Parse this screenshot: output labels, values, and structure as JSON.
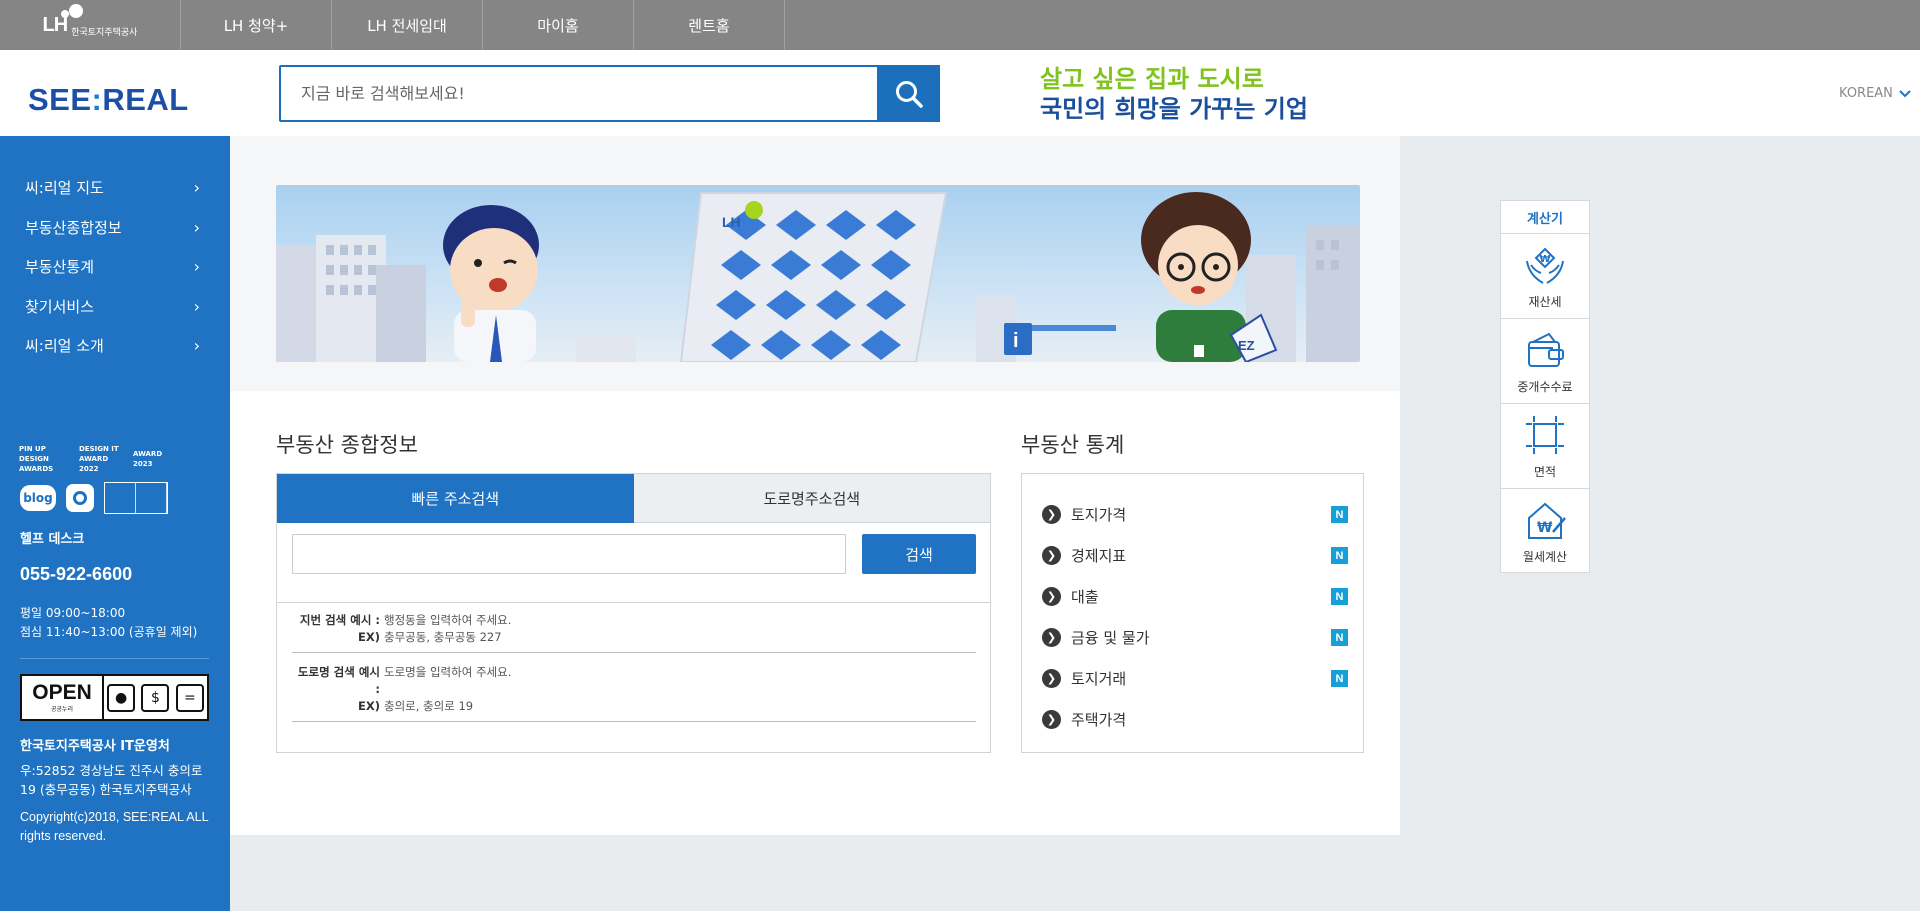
{
  "topbar": {
    "logo_mark": "LH",
    "logo_name": "한국토지주택공사",
    "nav": [
      "LH 청약+",
      "LH 전세임대",
      "마이홈",
      "렌트홈"
    ]
  },
  "header": {
    "brand_left": "SEE",
    "brand_sep": ":",
    "brand_right": "REAL",
    "search_placeholder": "지금 바로 검색해보세요!",
    "slogan_line1": "살고 싶은 집과 도시로",
    "slogan_line2": "국민의 희망을 가꾸는 기업",
    "language": "KOREAN"
  },
  "sidebar": {
    "menu": [
      "씨:리얼 지도",
      "부동산종합정보",
      "부동산통계",
      "찾기서비스",
      "씨:리얼 소개"
    ],
    "awards": [
      "PIN UP DESIGN AWARDS",
      "DESIGN IT AWARD 2022",
      "AWARD 2023"
    ],
    "blog_label": "blog",
    "helpdesk_title": "헬프 데스크",
    "helpdesk_phone": "055-922-6600",
    "hours_weekday": "평일 09:00~18:00",
    "hours_lunch": "점심 11:40~13:00 (공휴일 제외)",
    "open_badge": "OPEN",
    "open_badge_sub": "공공누리",
    "org": "한국토지주택공사 IT운영처",
    "address": "우:52852 경상남도 진주시 충의로 19 (충무공동) 한국토지주택공사",
    "copyright": "Copyright(c)2018, SEE:REAL ALL rights reserved."
  },
  "main": {
    "address_title": "부동산 종합정보",
    "tabs": [
      "빠른 주소검색",
      "도로명주소검색"
    ],
    "search_button": "검색",
    "examples": [
      {
        "key": "지번 검색 예시 :",
        "desc": "행정동을 입력하여 주세요.",
        "ex_key": "EX)",
        "ex": "충무공동, 충무공동 227"
      },
      {
        "key": "도로명 검색 예시 :",
        "desc": "도로명을 입력하여 주세요.",
        "ex_key": "EX)",
        "ex": "충의로, 충의로 19"
      }
    ],
    "stats_title": "부동산 통계",
    "stats": [
      {
        "label": "토지가격",
        "new": "N"
      },
      {
        "label": "경제지표",
        "new": "N"
      },
      {
        "label": "대출",
        "new": "N"
      },
      {
        "label": "금융 및 물가",
        "new": "N"
      },
      {
        "label": "토지거래",
        "new": "N"
      },
      {
        "label": "주택가격",
        "new": ""
      }
    ]
  },
  "calculator": {
    "title": "계산기",
    "items": [
      {
        "label": "재산세",
        "icon": "hands-won-icon"
      },
      {
        "label": "중개수수료",
        "icon": "wallet-icon"
      },
      {
        "label": "면적",
        "icon": "area-square-icon"
      },
      {
        "label": "월세계산",
        "icon": "house-won-icon"
      }
    ]
  },
  "colors": {
    "primary": "#1f73c2",
    "topbar": "#858585",
    "slogan_green": "#7fc31c",
    "slogan_blue": "#1b4f9b",
    "new_badge": "#17a0d8"
  }
}
